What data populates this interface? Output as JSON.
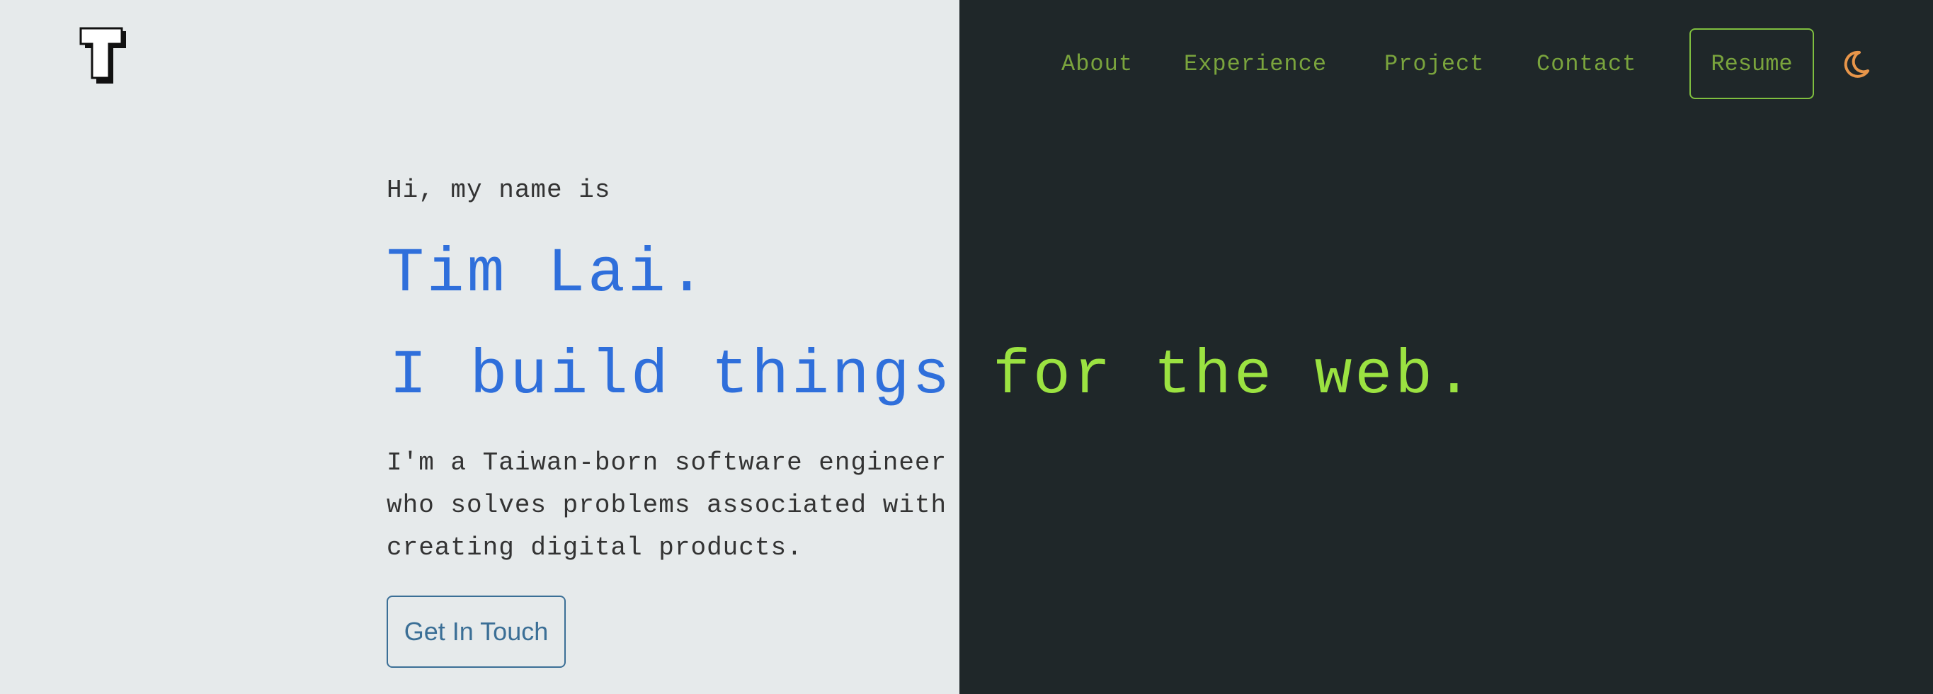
{
  "nav": {
    "logo_icon": "T-logo-icon",
    "links": [
      "About",
      "Experience",
      "Project",
      "Contact"
    ],
    "resume": "Resume",
    "theme_icon": "moon-icon"
  },
  "hero": {
    "greeting": "Hi, my name is",
    "name": "Tim Lai.",
    "tagline": "I build things for the web.",
    "description": [
      "I'm a Taiwan-born software engineer",
      "who solves problems associated with",
      "creating digital products."
    ],
    "cta": "Get In Touch"
  },
  "colors": {
    "light_bg": "#e6eaeb",
    "dark_bg": "#1f2729",
    "blue": "#2f6fdb",
    "green": "#9be241",
    "nav_green": "#7aa43d",
    "moon_orange": "#e8964a"
  }
}
